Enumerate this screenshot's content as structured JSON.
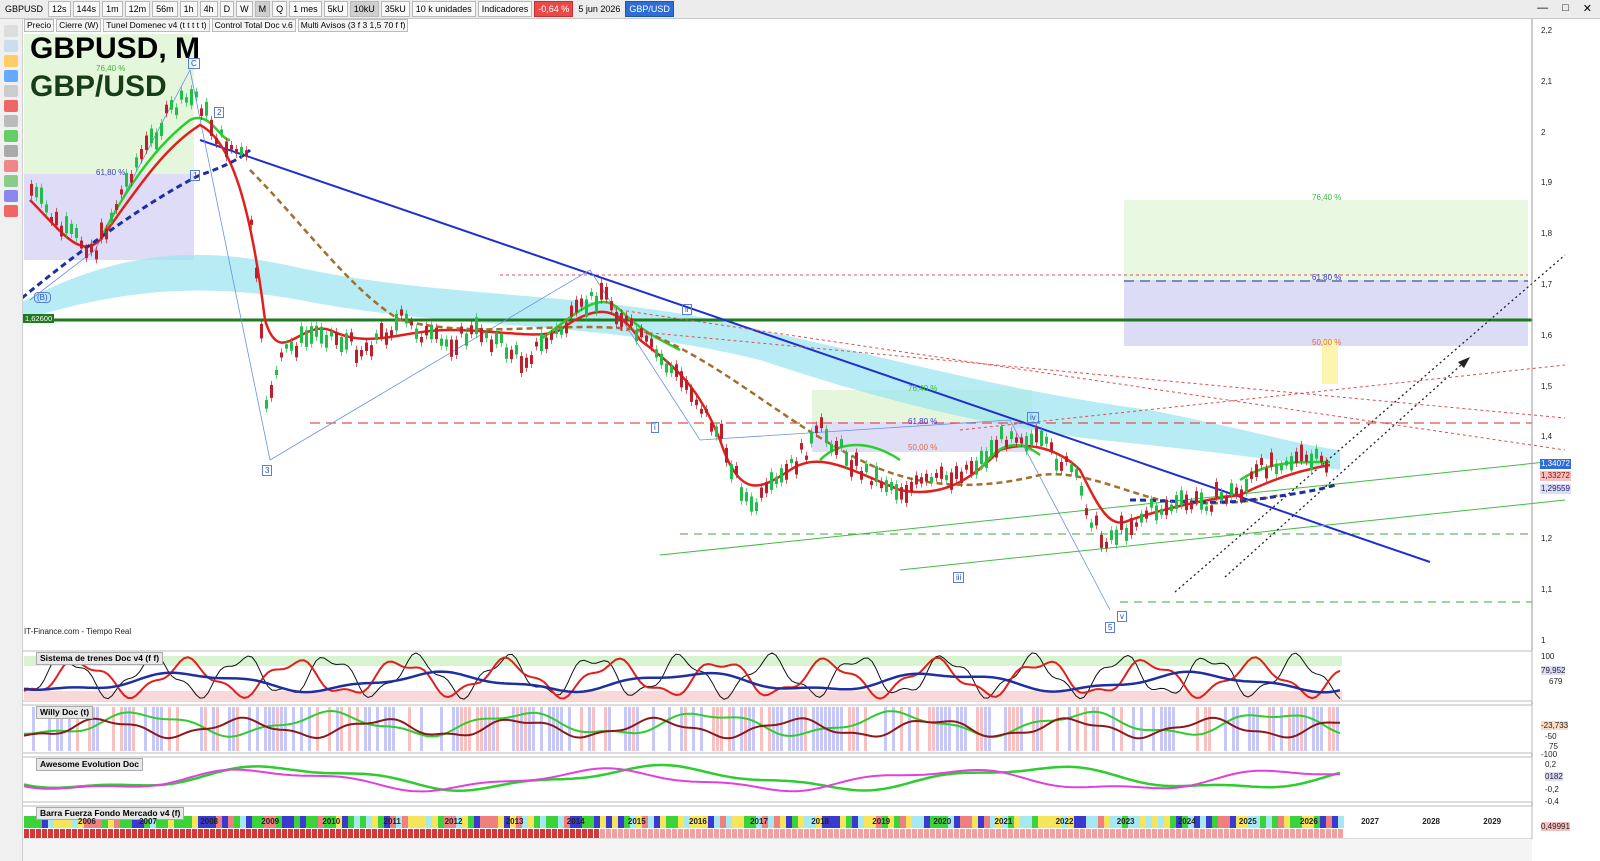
{
  "toolbar": {
    "symbol": "GBPUSD",
    "timeframes": [
      "12s",
      "144s",
      "1m",
      "12m",
      "56m",
      "1h",
      "4h",
      "D",
      "W",
      "M",
      "Q"
    ],
    "period": "1 mes",
    "units": [
      "5kU",
      "10kU",
      "35kU"
    ],
    "unit_select": "10 k unidades",
    "indicators_label": "Indicadores",
    "change": "-0,64 %",
    "date": "5 jun 2026",
    "pair_badge": "GBP/USD"
  },
  "legend": {
    "items": [
      "Precio",
      "Cierre (W)",
      "Tunel Domenec v4 (t t t t t)",
      "Control Total Doc v.6",
      "Multi Avisos (3 f 3 1,5 70 f f)"
    ]
  },
  "chart_title": "GBPUSD, M",
  "chart_subtitle": "GBP/USD",
  "source_label": "IT-Finance.com - Tiempo Real",
  "price_axis": [
    "2,2",
    "2,1",
    "2",
    "1,9",
    "1,8",
    "1,7",
    "1,6",
    "1,5",
    "1,4",
    "1,3",
    "1,2",
    "1,1",
    "1"
  ],
  "price_tags": {
    "last": "1,34072",
    "second": "1,33272",
    "third": "1,29559",
    "level_line": "1,62600"
  },
  "years": [
    "2006",
    "2007",
    "2008",
    "2009",
    "2010",
    "2011",
    "2012",
    "2013",
    "2014",
    "2015",
    "2016",
    "2017",
    "2018",
    "2019",
    "2020",
    "2021",
    "2022",
    "2023",
    "2024",
    "2025",
    "2026",
    "2027",
    "2028",
    "2029"
  ],
  "annotations": {
    "fib_764": "76,40 %",
    "fib_618": "61,80 %",
    "fib_50": "50,00 %",
    "wave_labels": [
      "C",
      "2",
      "1",
      "3",
      "(B)",
      "ii",
      "i",
      "iv",
      "iii",
      "v",
      "5"
    ]
  },
  "panels": {
    "p1": {
      "label": "Sistema de trenes Doc v4 (f f)",
      "axis": [
        "100",
        "79,952",
        "679"
      ]
    },
    "p2": {
      "label": "Willy Doc (t)",
      "axis": [
        "-23,733",
        "-50",
        "75",
        "-100"
      ]
    },
    "p3": {
      "label": "Awesome Evolution Doc",
      "axis": [
        "0,2",
        "0182",
        "-0,2",
        "-0,4"
      ]
    },
    "p4": {
      "label": "Barra Fuerza Fondo Mercado v4 (f)",
      "axis": [
        "0,49991"
      ]
    }
  },
  "colors": {
    "trendline": "#1f2fd0",
    "level_green": "#1e7a1e",
    "ma_red": "#e0201c",
    "ma_green": "#2ecc2e",
    "ma_brown": "#a0702c",
    "ma_blue_dotted": "#1f2fa0",
    "cloud": "#9fe6f0"
  }
}
